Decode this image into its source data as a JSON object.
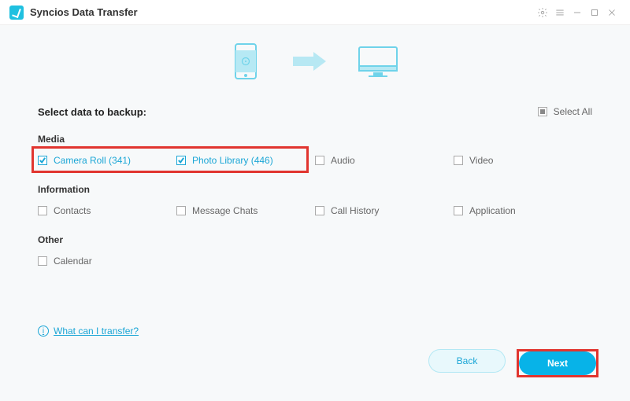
{
  "titlebar": {
    "title": "Syncios Data Transfer"
  },
  "header": {
    "heading": "Select data to backup:",
    "select_all": "Select All"
  },
  "categories": {
    "media": {
      "label": "Media",
      "items": [
        {
          "label": "Camera Roll (341)",
          "checked": true
        },
        {
          "label": "Photo Library (446)",
          "checked": true
        },
        {
          "label": "Audio",
          "checked": false
        },
        {
          "label": "Video",
          "checked": false
        }
      ]
    },
    "information": {
      "label": "Information",
      "items": [
        {
          "label": "Contacts",
          "checked": false
        },
        {
          "label": "Message Chats",
          "checked": false
        },
        {
          "label": "Call History",
          "checked": false
        },
        {
          "label": "Application",
          "checked": false
        }
      ]
    },
    "other": {
      "label": "Other",
      "items": [
        {
          "label": "Calendar",
          "checked": false
        }
      ]
    }
  },
  "help": {
    "link": "What can I transfer?"
  },
  "footer": {
    "back": "Back",
    "next": "Next"
  }
}
